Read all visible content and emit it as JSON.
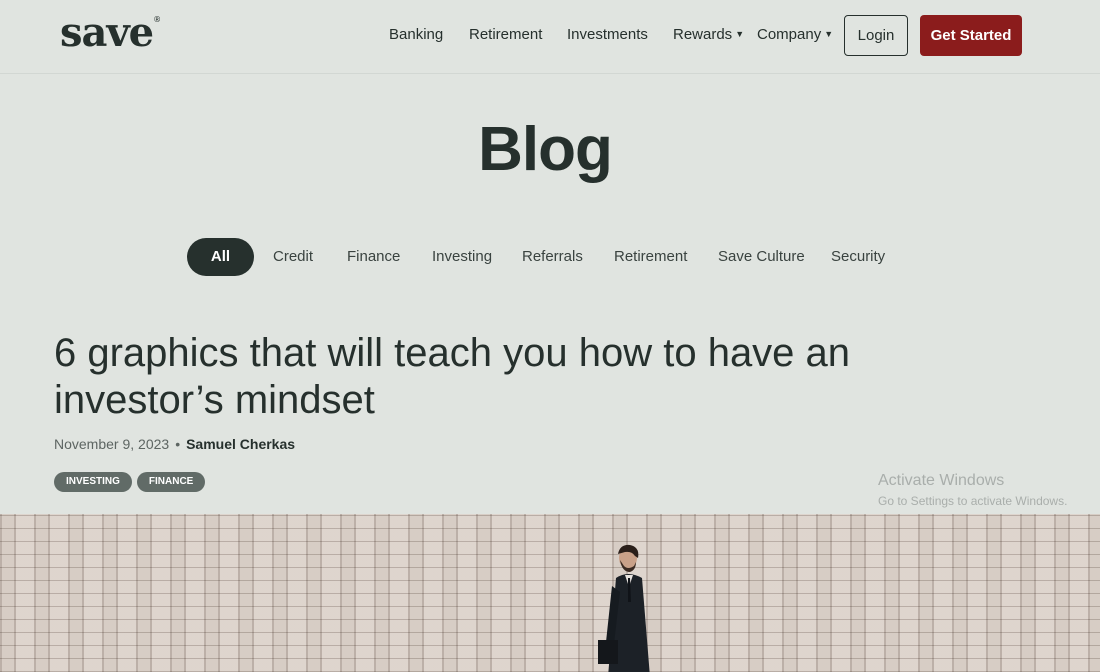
{
  "header": {
    "logo": "save",
    "logo_mark": "®",
    "nav": {
      "banking": "Banking",
      "retirement": "Retirement",
      "investments": "Investments",
      "rewards": "Rewards",
      "company": "Company"
    },
    "login_label": "Login",
    "get_started_label": "Get Started",
    "get_started_color": "#8b1c1c"
  },
  "page_title": "Blog",
  "filters": {
    "all": "All",
    "credit": "Credit",
    "finance": "Finance",
    "investing": "Investing",
    "referrals": "Referrals",
    "retirement": "Retirement",
    "save_culture": "Save Culture",
    "security": "Security",
    "active_color": "#26302d"
  },
  "post": {
    "title": "6 graphics that will teach you how to have an investor’s mindset",
    "date": "November 9, 2023",
    "separator": "•",
    "author": "Samuel Cherkas",
    "tags": [
      "INVESTING",
      "FINANCE"
    ]
  },
  "watermark": {
    "line1": "Activate Windows",
    "line2": "Go to Settings to activate Windows."
  },
  "icons": {
    "dropdown": "caret-down-icon"
  }
}
